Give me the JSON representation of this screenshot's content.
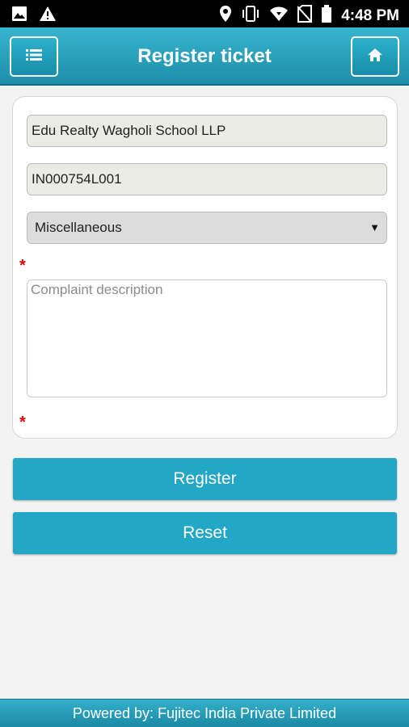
{
  "status_bar": {
    "time": "4:48 PM",
    "icons": [
      "image-icon",
      "warning-icon",
      "location-icon",
      "vibrate-icon",
      "wifi-icon",
      "no-sim-icon",
      "battery-icon"
    ]
  },
  "header": {
    "title": "Register ticket",
    "menu_icon": "list-icon",
    "home_icon": "home-icon",
    "accent_color": "#22a7c6"
  },
  "form": {
    "company_name": "Edu Realty Wagholi School LLP",
    "site_code": "IN000754L001",
    "category_selected": "Miscellaneous",
    "required_marker": "*",
    "description_placeholder": "Complaint description",
    "description_value": ""
  },
  "actions": {
    "register_label": "Register",
    "reset_label": "Reset"
  },
  "footer": {
    "text": "Powered by: Fujitec India Private Limited"
  }
}
